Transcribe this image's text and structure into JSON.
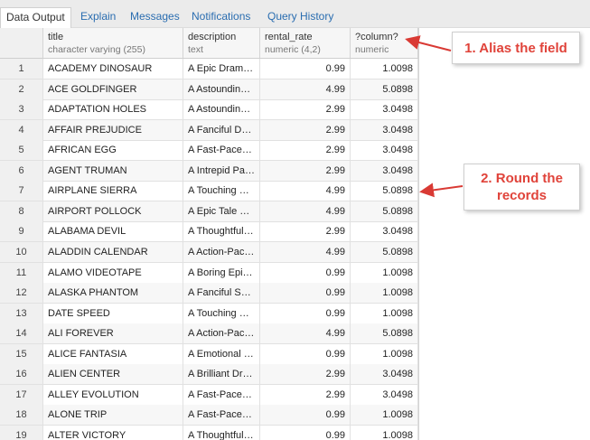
{
  "tabs": [
    {
      "label": "Data Output",
      "active": true
    },
    {
      "label": "Explain",
      "active": false
    },
    {
      "label": "Messages",
      "active": false
    },
    {
      "label": "Notifications",
      "active": false
    },
    {
      "label": "Query History",
      "active": false
    }
  ],
  "columns": [
    {
      "name": "title",
      "type": "character varying (255)"
    },
    {
      "name": "description",
      "type": "text"
    },
    {
      "name": "rental_rate",
      "type": "numeric (4,2)"
    },
    {
      "name": "?column?",
      "type": "numeric"
    }
  ],
  "rows": [
    {
      "index": "1",
      "title": "ACADEMY DINOSAUR",
      "description": "A Epic Drama of a Feminist",
      "rental_rate": "0.99",
      "column": "1.0098"
    },
    {
      "index": "2",
      "title": "ACE GOLDFINGER",
      "description": "A Astounding Epistle of a Database",
      "rental_rate": "4.99",
      "column": "5.0898"
    },
    {
      "index": "3",
      "title": "ADAPTATION HOLES",
      "description": "A Astounding Reflection of a Lumberjack",
      "rental_rate": "2.99",
      "column": "3.0498"
    },
    {
      "index": "4",
      "title": "AFFAIR PREJUDICE",
      "description": "A Fanciful Documentary of a Frisbee",
      "rental_rate": "2.99",
      "column": "3.0498"
    },
    {
      "index": "5",
      "title": "AFRICAN EGG",
      "description": "A Fast-Paced Documentary of a Pastry Chef",
      "rental_rate": "2.99",
      "column": "3.0498"
    },
    {
      "index": "6",
      "title": "AGENT TRUMAN",
      "description": "A Intrepid Panorama of a Robot",
      "rental_rate": "2.99",
      "column": "3.0498"
    },
    {
      "index": "7",
      "title": "AIRPLANE SIERRA",
      "description": "A Touching Saga of a Hunter",
      "rental_rate": "4.99",
      "column": "5.0898"
    },
    {
      "index": "8",
      "title": "AIRPORT POLLOCK",
      "description": "A Epic Tale of a Moose",
      "rental_rate": "4.99",
      "column": "5.0898"
    },
    {
      "index": "9",
      "title": "ALABAMA DEVIL",
      "description": "A Thoughtful Panorama of a Database",
      "rental_rate": "2.99",
      "column": "3.0498"
    },
    {
      "index": "10",
      "title": "ALADDIN CALENDAR",
      "description": "A Action-Packed Tale of a Man",
      "rental_rate": "4.99",
      "column": "5.0898"
    },
    {
      "index": "11",
      "title": "ALAMO VIDEOTAPE",
      "description": "A Boring Epistle of a Butler",
      "rental_rate": "0.99",
      "column": "1.0098"
    },
    {
      "index": "12",
      "title": "ALASKA PHANTOM",
      "description": "A Fanciful Saga of a Hunter",
      "rental_rate": "0.99",
      "column": "1.0098"
    },
    {
      "index": "13",
      "title": "DATE SPEED",
      "description": "A Touching Saga of a Composer",
      "rental_rate": "0.99",
      "column": "1.0098"
    },
    {
      "index": "14",
      "title": "ALI FOREVER",
      "description": "A Action-Packed Drama of a Dentist",
      "rental_rate": "4.99",
      "column": "5.0898"
    },
    {
      "index": "15",
      "title": "ALICE FANTASIA",
      "description": "A Emotional Drama of a A Shark",
      "rental_rate": "0.99",
      "column": "1.0098"
    },
    {
      "index": "16",
      "title": "ALIEN CENTER",
      "description": "A Brilliant Drama of a Cat",
      "rental_rate": "2.99",
      "column": "3.0498"
    },
    {
      "index": "17",
      "title": "ALLEY EVOLUTION",
      "description": "A Fast-Paced Drama of a Robot",
      "rental_rate": "2.99",
      "column": "3.0498"
    },
    {
      "index": "18",
      "title": "ALONE TRIP",
      "description": "A Fast-Paced Character Study of a Composer",
      "rental_rate": "0.99",
      "column": "1.0098"
    },
    {
      "index": "19",
      "title": "ALTER VICTORY",
      "description": "A Thoughtful Drama of a Composer",
      "rental_rate": "0.99",
      "column": "1.0098"
    }
  ],
  "annotations": [
    {
      "text": "1. Alias the field"
    },
    {
      "text": "2. Round the records"
    }
  ],
  "colors": {
    "annotation_text": "#e0433a",
    "arrow": "#d93a34",
    "tab_link": "#2a6db0"
  }
}
